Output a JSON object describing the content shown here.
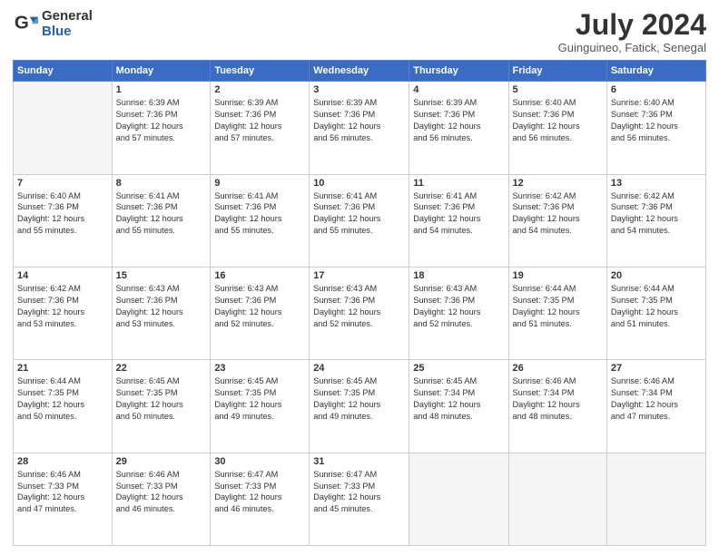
{
  "logo": {
    "general": "General",
    "blue": "Blue"
  },
  "header": {
    "title": "July 2024",
    "location": "Guinguineo, Fatick, Senegal"
  },
  "days_of_week": [
    "Sunday",
    "Monday",
    "Tuesday",
    "Wednesday",
    "Thursday",
    "Friday",
    "Saturday"
  ],
  "weeks": [
    [
      {
        "day": "",
        "info": ""
      },
      {
        "day": "1",
        "info": "Sunrise: 6:39 AM\nSunset: 7:36 PM\nDaylight: 12 hours\nand 57 minutes."
      },
      {
        "day": "2",
        "info": "Sunrise: 6:39 AM\nSunset: 7:36 PM\nDaylight: 12 hours\nand 57 minutes."
      },
      {
        "day": "3",
        "info": "Sunrise: 6:39 AM\nSunset: 7:36 PM\nDaylight: 12 hours\nand 56 minutes."
      },
      {
        "day": "4",
        "info": "Sunrise: 6:39 AM\nSunset: 7:36 PM\nDaylight: 12 hours\nand 56 minutes."
      },
      {
        "day": "5",
        "info": "Sunrise: 6:40 AM\nSunset: 7:36 PM\nDaylight: 12 hours\nand 56 minutes."
      },
      {
        "day": "6",
        "info": "Sunrise: 6:40 AM\nSunset: 7:36 PM\nDaylight: 12 hours\nand 56 minutes."
      }
    ],
    [
      {
        "day": "7",
        "info": "Sunrise: 6:40 AM\nSunset: 7:36 PM\nDaylight: 12 hours\nand 55 minutes."
      },
      {
        "day": "8",
        "info": "Sunrise: 6:41 AM\nSunset: 7:36 PM\nDaylight: 12 hours\nand 55 minutes."
      },
      {
        "day": "9",
        "info": "Sunrise: 6:41 AM\nSunset: 7:36 PM\nDaylight: 12 hours\nand 55 minutes."
      },
      {
        "day": "10",
        "info": "Sunrise: 6:41 AM\nSunset: 7:36 PM\nDaylight: 12 hours\nand 55 minutes."
      },
      {
        "day": "11",
        "info": "Sunrise: 6:41 AM\nSunset: 7:36 PM\nDaylight: 12 hours\nand 54 minutes."
      },
      {
        "day": "12",
        "info": "Sunrise: 6:42 AM\nSunset: 7:36 PM\nDaylight: 12 hours\nand 54 minutes."
      },
      {
        "day": "13",
        "info": "Sunrise: 6:42 AM\nSunset: 7:36 PM\nDaylight: 12 hours\nand 54 minutes."
      }
    ],
    [
      {
        "day": "14",
        "info": "Sunrise: 6:42 AM\nSunset: 7:36 PM\nDaylight: 12 hours\nand 53 minutes."
      },
      {
        "day": "15",
        "info": "Sunrise: 6:43 AM\nSunset: 7:36 PM\nDaylight: 12 hours\nand 53 minutes."
      },
      {
        "day": "16",
        "info": "Sunrise: 6:43 AM\nSunset: 7:36 PM\nDaylight: 12 hours\nand 52 minutes."
      },
      {
        "day": "17",
        "info": "Sunrise: 6:43 AM\nSunset: 7:36 PM\nDaylight: 12 hours\nand 52 minutes."
      },
      {
        "day": "18",
        "info": "Sunrise: 6:43 AM\nSunset: 7:36 PM\nDaylight: 12 hours\nand 52 minutes."
      },
      {
        "day": "19",
        "info": "Sunrise: 6:44 AM\nSunset: 7:35 PM\nDaylight: 12 hours\nand 51 minutes."
      },
      {
        "day": "20",
        "info": "Sunrise: 6:44 AM\nSunset: 7:35 PM\nDaylight: 12 hours\nand 51 minutes."
      }
    ],
    [
      {
        "day": "21",
        "info": "Sunrise: 6:44 AM\nSunset: 7:35 PM\nDaylight: 12 hours\nand 50 minutes."
      },
      {
        "day": "22",
        "info": "Sunrise: 6:45 AM\nSunset: 7:35 PM\nDaylight: 12 hours\nand 50 minutes."
      },
      {
        "day": "23",
        "info": "Sunrise: 6:45 AM\nSunset: 7:35 PM\nDaylight: 12 hours\nand 49 minutes."
      },
      {
        "day": "24",
        "info": "Sunrise: 6:45 AM\nSunset: 7:35 PM\nDaylight: 12 hours\nand 49 minutes."
      },
      {
        "day": "25",
        "info": "Sunrise: 6:45 AM\nSunset: 7:34 PM\nDaylight: 12 hours\nand 48 minutes."
      },
      {
        "day": "26",
        "info": "Sunrise: 6:46 AM\nSunset: 7:34 PM\nDaylight: 12 hours\nand 48 minutes."
      },
      {
        "day": "27",
        "info": "Sunrise: 6:46 AM\nSunset: 7:34 PM\nDaylight: 12 hours\nand 47 minutes."
      }
    ],
    [
      {
        "day": "28",
        "info": "Sunrise: 6:46 AM\nSunset: 7:33 PM\nDaylight: 12 hours\nand 47 minutes."
      },
      {
        "day": "29",
        "info": "Sunrise: 6:46 AM\nSunset: 7:33 PM\nDaylight: 12 hours\nand 46 minutes."
      },
      {
        "day": "30",
        "info": "Sunrise: 6:47 AM\nSunset: 7:33 PM\nDaylight: 12 hours\nand 46 minutes."
      },
      {
        "day": "31",
        "info": "Sunrise: 6:47 AM\nSunset: 7:33 PM\nDaylight: 12 hours\nand 45 minutes."
      },
      {
        "day": "",
        "info": ""
      },
      {
        "day": "",
        "info": ""
      },
      {
        "day": "",
        "info": ""
      }
    ]
  ]
}
